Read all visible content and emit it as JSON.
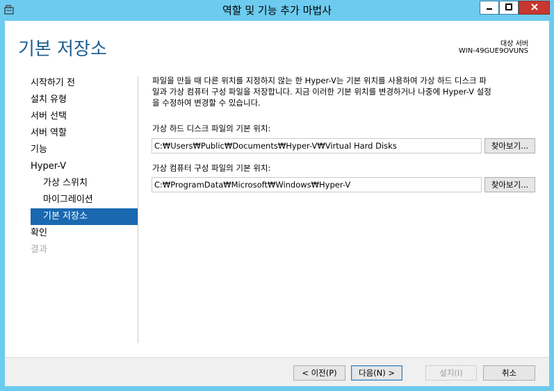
{
  "window": {
    "title": "역할 및 기능 추가 마법사",
    "min_label": "▁",
    "max_label": "□",
    "close_label": "X"
  },
  "header": {
    "page_title": "기본 저장소",
    "target_label": "대상 서버",
    "target_name": "WIN-49GUE9OVUNS"
  },
  "nav": {
    "items": [
      {
        "label": "시작하기 전",
        "state": "normal"
      },
      {
        "label": "설치 유형",
        "state": "normal"
      },
      {
        "label": "서버 선택",
        "state": "normal"
      },
      {
        "label": "서버 역할",
        "state": "normal"
      },
      {
        "label": "기능",
        "state": "normal"
      },
      {
        "label": "Hyper-V",
        "state": "normal"
      },
      {
        "label": "가상 스위치",
        "state": "sub"
      },
      {
        "label": "마이그레이션",
        "state": "sub"
      },
      {
        "label": "기본 저장소",
        "state": "selected"
      },
      {
        "label": "확인",
        "state": "normal"
      },
      {
        "label": "결과",
        "state": "disabled"
      }
    ]
  },
  "main": {
    "description_line1": "파일을 만들 때 다른 위치를 지정하지 않는 한 Hyper-V는 기본 위치를 사용하여 가상 하드 디스크 파",
    "description_line2": "일과 가상 컴퓨터 구성 파일을 저장합니다. 지금 이러한 기본 위치를 변경하거나 나중에 Hyper-V 설정",
    "description_line3": "을 수정하여 변경할 수 있습니다.",
    "vhd_label": "가상 하드 디스크 파일의 기본 위치:",
    "vhd_path": "C:₩Users₩Public₩Documents₩Hyper-V₩Virtual Hard Disks",
    "vm_label": "가상 컴퓨터 구성 파일의 기본 위치:",
    "vm_path": "C:₩ProgramData₩Microsoft₩Windows₩Hyper-V",
    "browse_label": "찾아보기..."
  },
  "footer": {
    "prev_label": "< 이전(P)",
    "next_label": "다음(N) >",
    "install_label": "설치(I)",
    "cancel_label": "취소"
  },
  "colors": {
    "accent": "#6ccbee",
    "title_blue": "#1e5f8f",
    "selected": "#1a68b0",
    "close_red": "#c7372f"
  }
}
